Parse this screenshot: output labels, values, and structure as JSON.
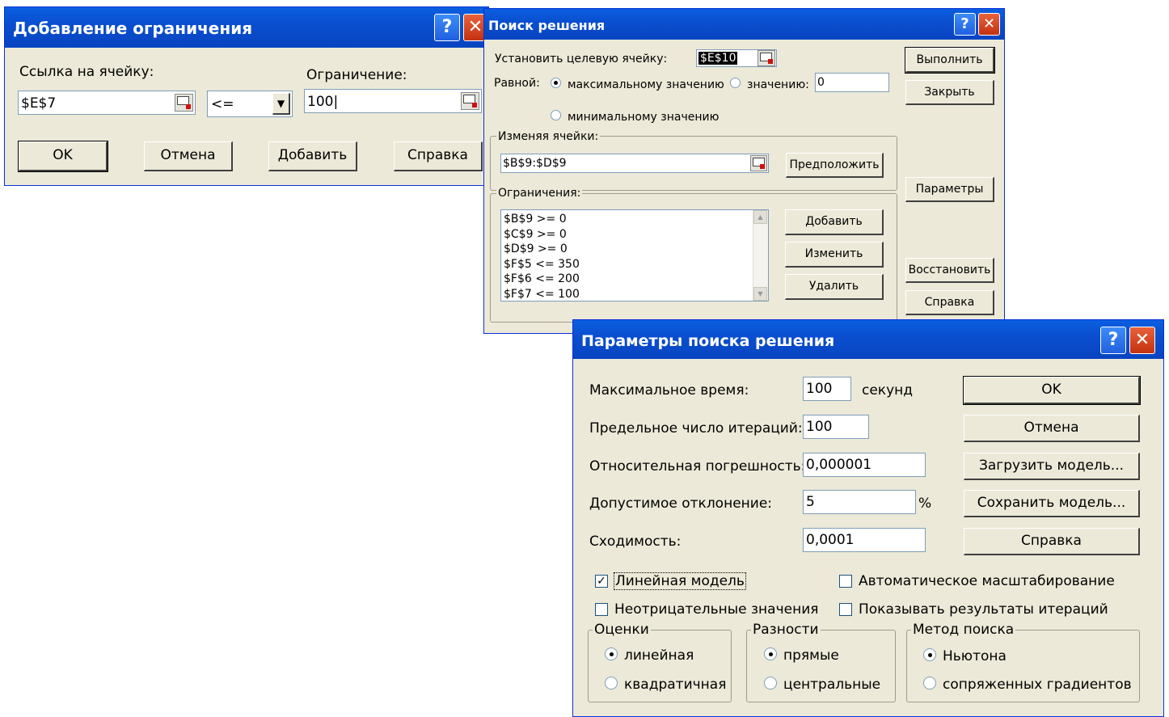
{
  "dialog1": {
    "title": "Добавление ограничения",
    "cell_ref_label": "Ссылка на ячейку:",
    "cell_ref_value": "$E$7",
    "operator_value": "<=",
    "constraint_label": "Ограничение:",
    "constraint_value": "100",
    "ok": "OK",
    "cancel": "Отмена",
    "add": "Добавить",
    "help": "Справка"
  },
  "dialog2": {
    "title": "Поиск решения",
    "target_label": "Установить целевую ячейку:",
    "target_value": "$E$10",
    "equal_label": "Равной:",
    "max_option": "максимальному значению",
    "value_option": "значению:",
    "value_field": "0",
    "min_option": "минимальному значению",
    "changing_label": "Изменяя ячейки:",
    "changing_value": "$B$9:$D$9",
    "guess": "Предположить",
    "constraints_label": "Ограничения:",
    "constraints": [
      "$B$9 >= 0",
      "$C$9 >= 0",
      "$D$9 >= 0",
      "$F$5 <= 350",
      "$F$6 <= 200",
      "$F$7 <= 100"
    ],
    "add": "Добавить",
    "change": "Изменить",
    "delete": "Удалить",
    "solve": "Выполнить",
    "close": "Закрыть",
    "options": "Параметры",
    "reset": "Восстановить",
    "help": "Справка"
  },
  "dialog3": {
    "title": "Параметры поиска решения",
    "max_time_label": "Максимальное время:",
    "max_time_value": "100",
    "seconds": "секунд",
    "iterations_label": "Предельное число итераций:",
    "iterations_value": "100",
    "precision_label": "Относительная погрешность:",
    "precision_value": "0,000001",
    "tolerance_label": "Допустимое отклонение:",
    "tolerance_value": "5",
    "percent": "%",
    "convergence_label": "Сходимость:",
    "convergence_value": "0,0001",
    "ok": "OK",
    "cancel": "Отмена",
    "load": "Загрузить модель...",
    "save": "Сохранить модель...",
    "help": "Справка",
    "linear_model": "Линейная модель",
    "auto_scale": "Автоматическое масштабирование",
    "non_negative": "Неотрицательные значения",
    "show_iterations": "Показывать результаты итераций",
    "estimates_title": "Оценки",
    "estimates_linear": "линейная",
    "estimates_quadratic": "квадратичная",
    "derivatives_title": "Разности",
    "derivatives_forward": "прямые",
    "derivatives_central": "центральные",
    "search_title": "Метод поиска",
    "search_newton": "Ньютона",
    "search_conjugate": "сопряженных градиентов"
  }
}
